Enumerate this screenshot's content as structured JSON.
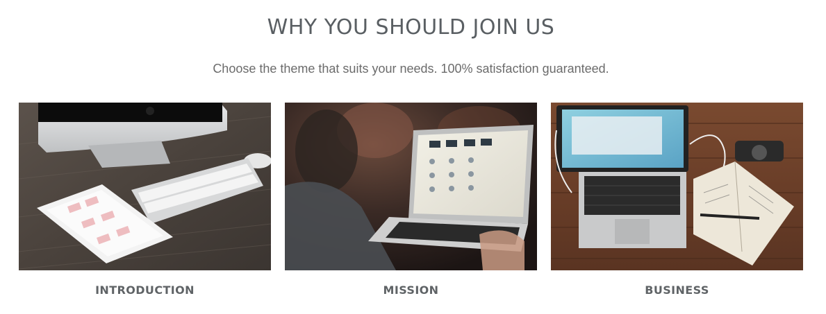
{
  "header": {
    "title": "WHY YOU SHOULD JOIN US",
    "subtitle": "Choose the theme that suits your needs. 100% satisfaction guaranteed."
  },
  "cards": [
    {
      "label": "INTRODUCTION",
      "image": "desk-imac-ipad-keyboard-photo"
    },
    {
      "label": "MISSION",
      "image": "person-using-laptop-photo"
    },
    {
      "label": "BUSINESS",
      "image": "laptop-notebook-wooden-table-photo"
    }
  ],
  "colors": {
    "title": "#5a5f63",
    "subtitle": "#6b6b6b",
    "label": "#5f6366"
  }
}
